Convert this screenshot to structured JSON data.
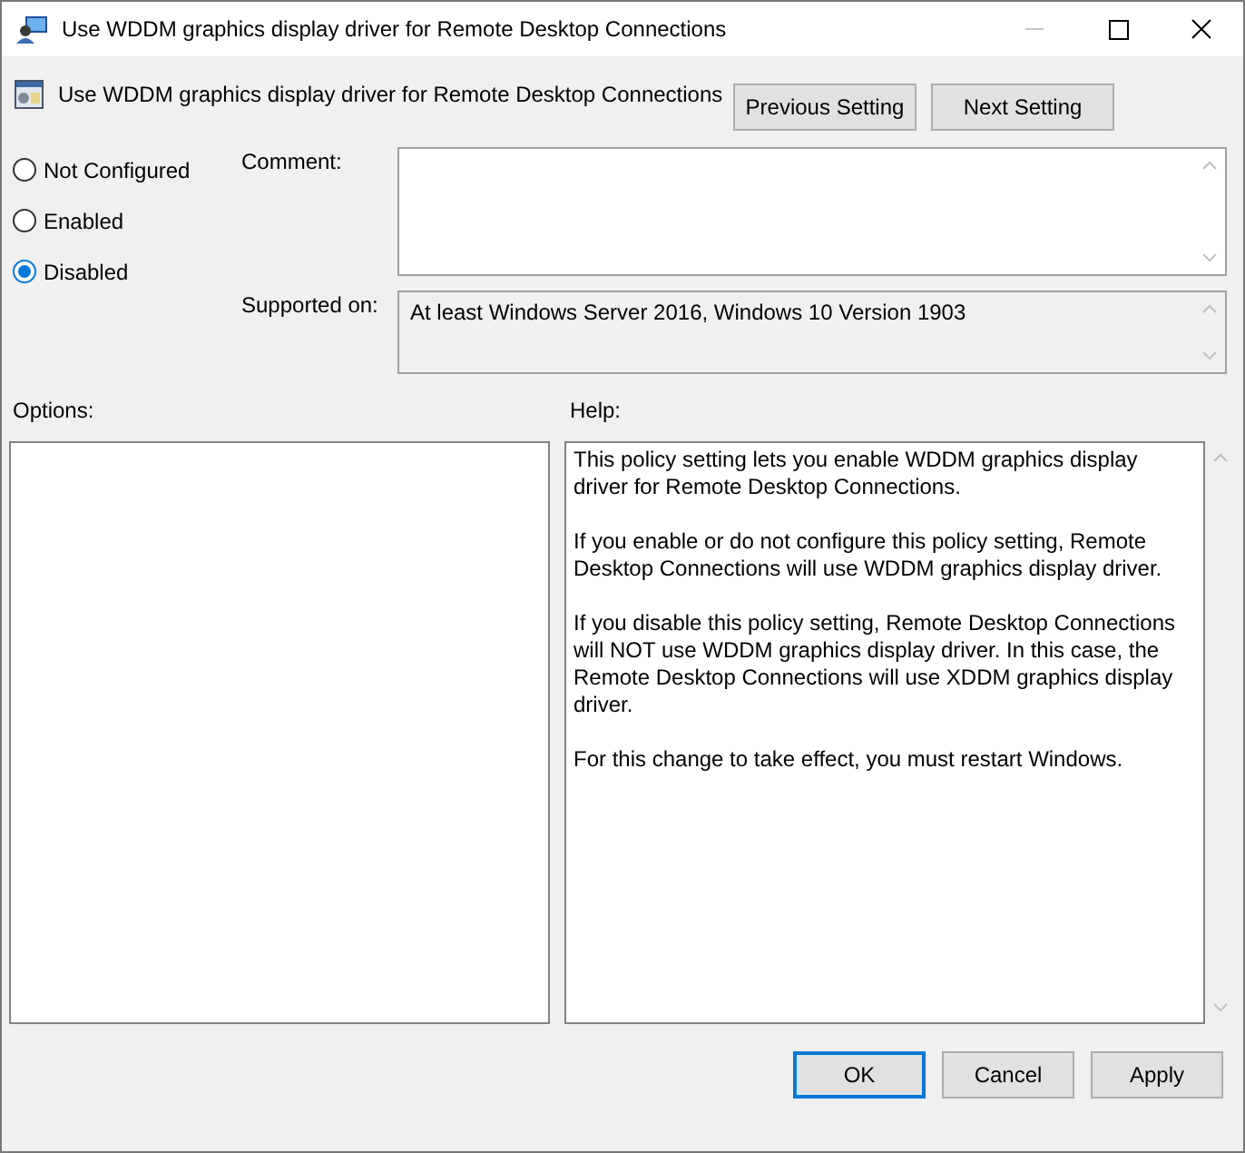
{
  "window": {
    "title": "Use WDDM graphics display driver for Remote Desktop Connections"
  },
  "setting_title": "Use WDDM graphics display driver for Remote Desktop Connections",
  "nav_buttons": [
    "Previous Setting",
    "Next Setting"
  ],
  "states": [
    {
      "label": "Not Configured",
      "selected": false
    },
    {
      "label": "Enabled",
      "selected": false
    },
    {
      "label": "Disabled",
      "selected": true
    }
  ],
  "comment": {
    "label": "Comment:"
  },
  "supported_on": {
    "label": "Supported on:",
    "value": "At least Windows Server 2016, Windows 10 Version 1903"
  },
  "options": {
    "label": "Options:"
  },
  "help": {
    "label": "Help:",
    "paragraphs": [
      "This policy setting lets you enable WDDM graphics display driver for Remote Desktop Connections.",
      "If you enable or do not configure this policy setting, Remote Desktop Connections will use WDDM graphics display driver.",
      "If you disable this policy setting, Remote Desktop Connections will NOT use WDDM graphics display driver. In this case, the Remote Desktop Connections will use XDDM graphics display driver.",
      "For this change to take effect, you must restart Windows."
    ]
  },
  "buttons": [
    {
      "label": "OK",
      "selected": true
    },
    {
      "label": "Cancel",
      "selected": false
    },
    {
      "label": "Apply",
      "selected": false
    }
  ]
}
